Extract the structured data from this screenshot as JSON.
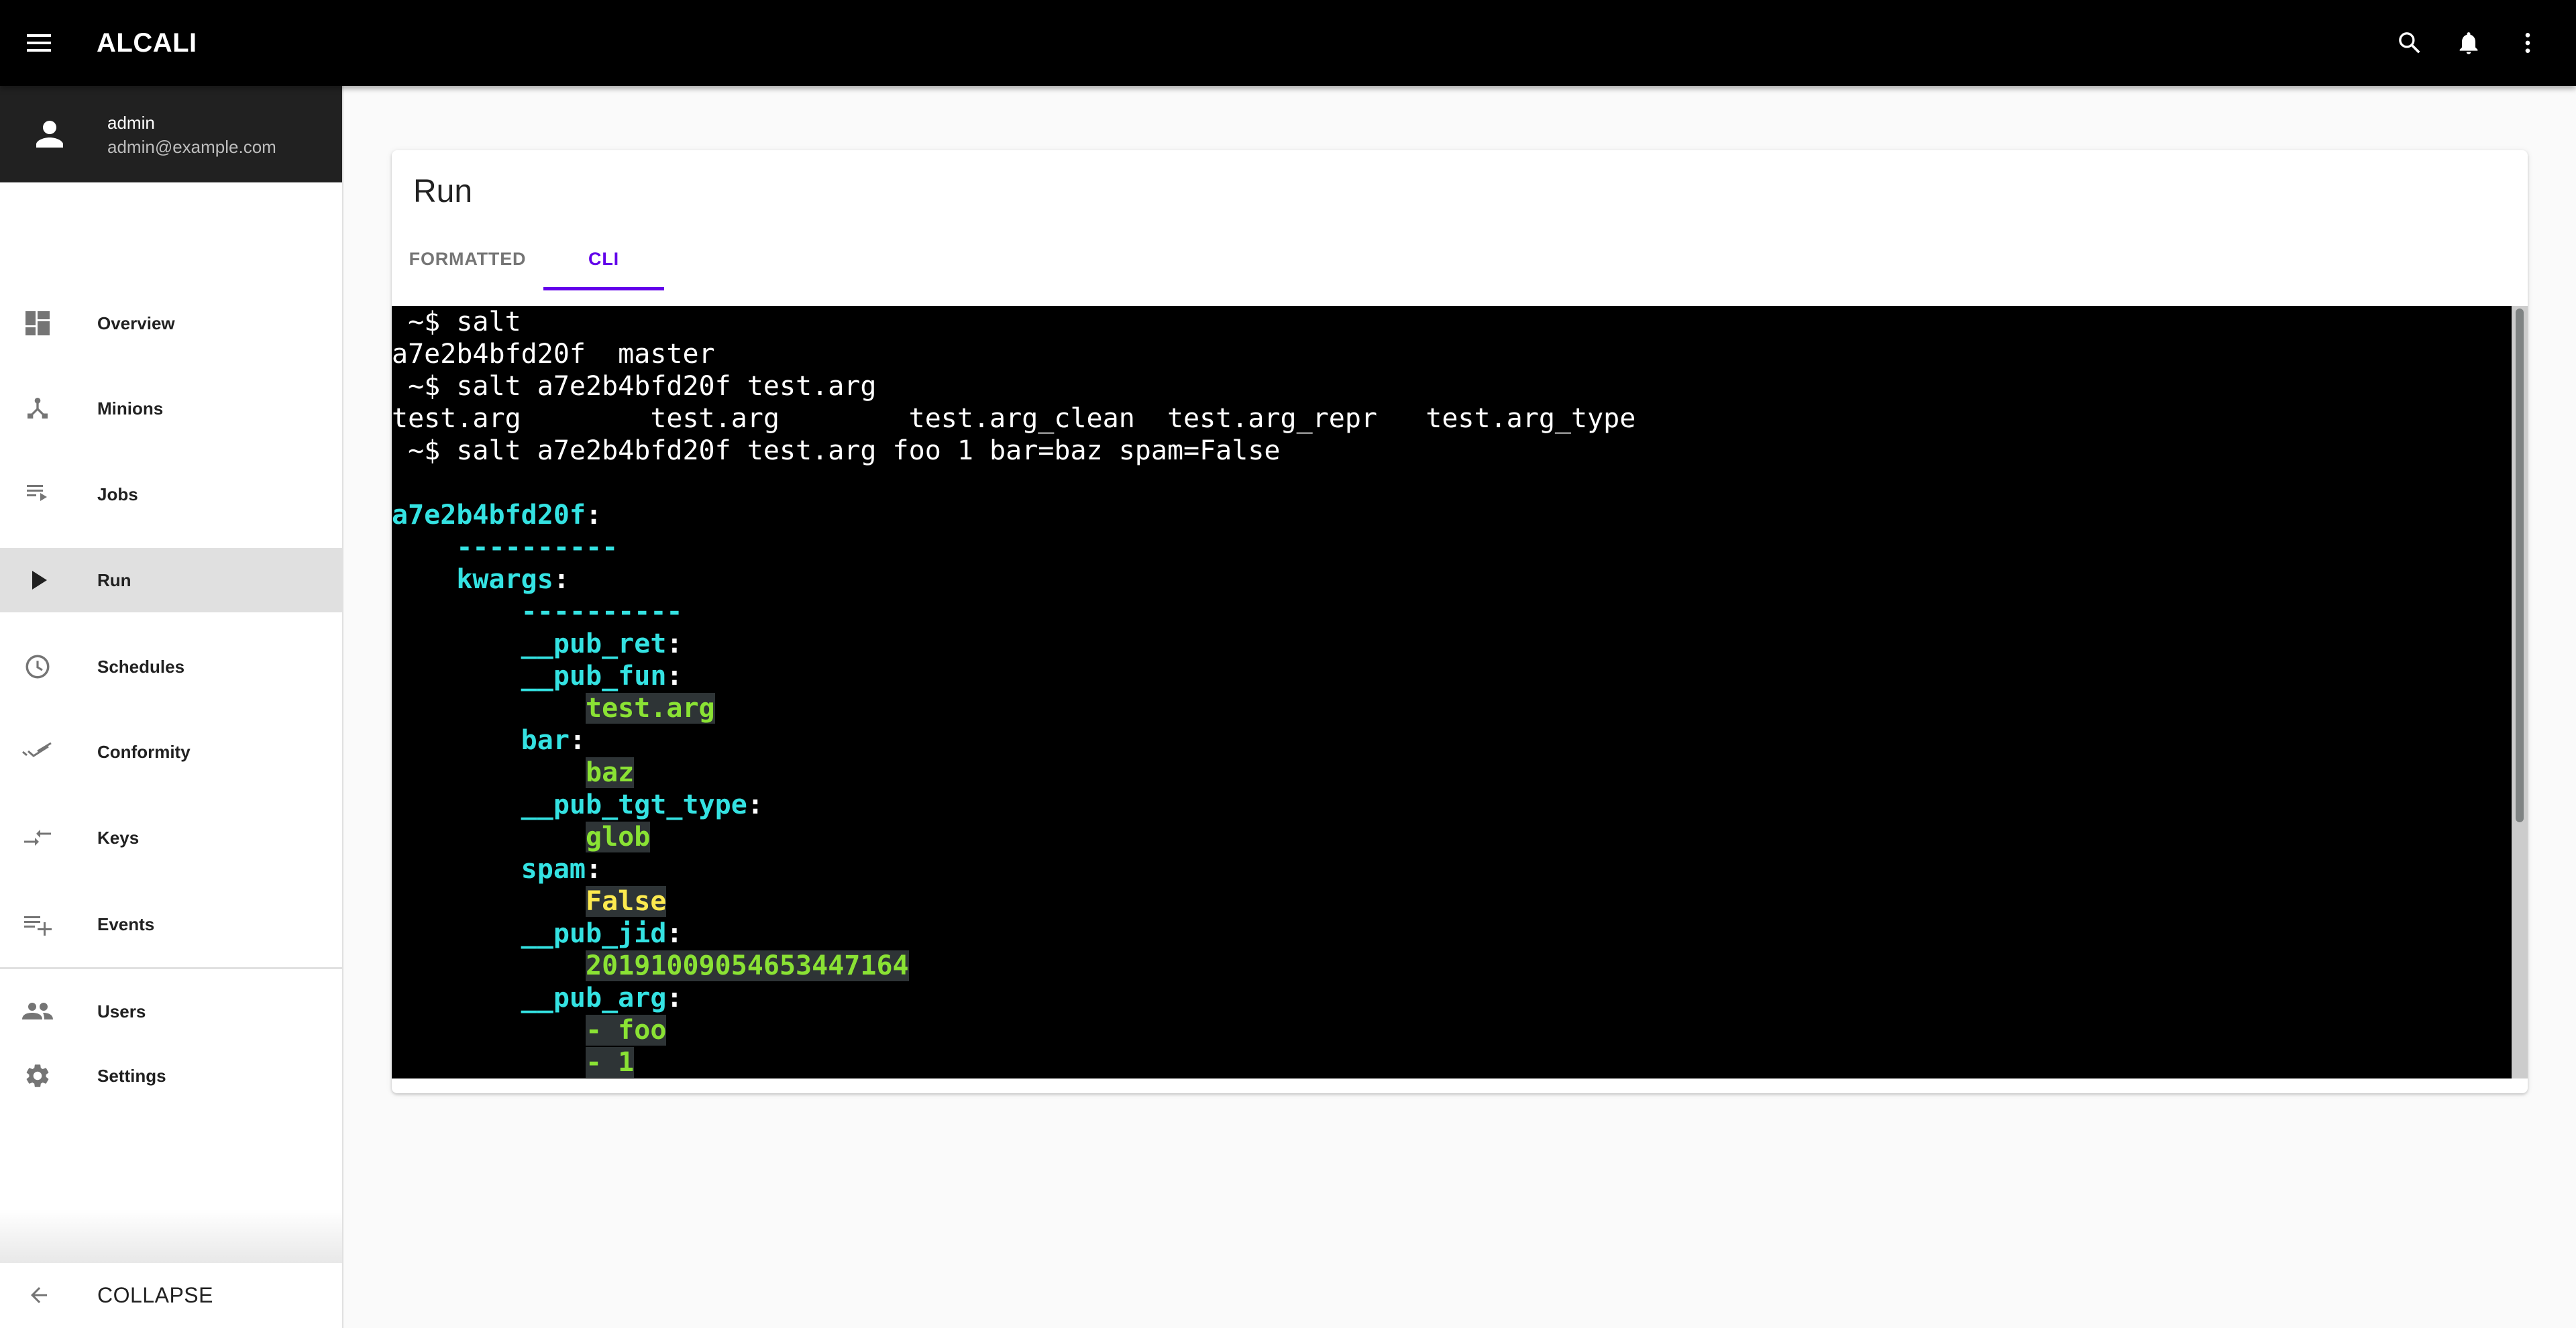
{
  "app": {
    "title": "ALCALI",
    "actions": [
      {
        "icon": "search-icon",
        "label": "Search"
      },
      {
        "icon": "bell-icon",
        "label": "Notifications"
      },
      {
        "icon": "more-vert-icon",
        "label": "More"
      }
    ]
  },
  "user": {
    "name": "admin",
    "email": "admin@example.com"
  },
  "sidebar": {
    "items": [
      {
        "label": "Overview",
        "icon": "dashboard-icon",
        "selected": false
      },
      {
        "label": "Minions",
        "icon": "device-hub-icon",
        "selected": false
      },
      {
        "label": "Jobs",
        "icon": "playlist-play-icon",
        "selected": false
      },
      {
        "label": "Run",
        "icon": "play-icon",
        "selected": true
      },
      {
        "label": "Schedules",
        "icon": "clock-icon",
        "selected": false
      },
      {
        "label": "Conformity",
        "icon": "done-all-icon",
        "selected": false
      },
      {
        "label": "Keys",
        "icon": "compare-arrows-icon",
        "selected": false
      },
      {
        "label": "Events",
        "icon": "playlist-add-icon",
        "selected": false
      }
    ],
    "secondary_items": [
      {
        "label": "Users",
        "icon": "people-icon"
      },
      {
        "label": "Settings",
        "icon": "gear-icon"
      }
    ],
    "collapse_label": "COLLAPSE"
  },
  "page": {
    "title": "Run",
    "tabs": [
      {
        "label": "FORMATTED",
        "active": false
      },
      {
        "label": "CLI",
        "active": true
      }
    ],
    "accent_color": "#6200ea"
  },
  "terminal": {
    "lines": [
      [
        {
          "t": " ~$ salt",
          "c": ""
        }
      ],
      [
        {
          "t": "a7e2b4bfd20f  master",
          "c": ""
        }
      ],
      [
        {
          "t": " ~$ salt a7e2b4bfd20f test.arg",
          "c": ""
        }
      ],
      [
        {
          "t": "test.arg        test.arg        test.arg_clean  test.arg_repr   test.arg_type",
          "c": ""
        }
      ],
      [
        {
          "t": " ~$ salt a7e2b4bfd20f test.arg foo 1 bar=baz spam=False",
          "c": ""
        }
      ],
      [
        {
          "t": "",
          "c": ""
        }
      ],
      [
        {
          "t": "a7e2b4bfd20f",
          "c": "key"
        },
        {
          "t": ":",
          "c": "punct"
        }
      ],
      [
        {
          "t": "    ",
          "c": ""
        },
        {
          "t": "----------",
          "c": "key"
        }
      ],
      [
        {
          "t": "    ",
          "c": ""
        },
        {
          "t": "kwargs",
          "c": "key"
        },
        {
          "t": ":",
          "c": "punct"
        }
      ],
      [
        {
          "t": "        ",
          "c": ""
        },
        {
          "t": "----------",
          "c": "key"
        }
      ],
      [
        {
          "t": "        ",
          "c": ""
        },
        {
          "t": "__pub_ret",
          "c": "key"
        },
        {
          "t": ":",
          "c": "punct"
        }
      ],
      [
        {
          "t": "        ",
          "c": ""
        },
        {
          "t": "__pub_fun",
          "c": "key"
        },
        {
          "t": ":",
          "c": "punct"
        }
      ],
      [
        {
          "t": "            ",
          "c": ""
        },
        {
          "t": "test.arg",
          "c": "val"
        }
      ],
      [
        {
          "t": "        ",
          "c": ""
        },
        {
          "t": "bar",
          "c": "key"
        },
        {
          "t": ":",
          "c": "punct"
        }
      ],
      [
        {
          "t": "            ",
          "c": ""
        },
        {
          "t": "baz",
          "c": "val"
        }
      ],
      [
        {
          "t": "        ",
          "c": ""
        },
        {
          "t": "__pub_tgt_type",
          "c": "key"
        },
        {
          "t": ":",
          "c": "punct"
        }
      ],
      [
        {
          "t": "            ",
          "c": ""
        },
        {
          "t": "glob",
          "c": "val"
        }
      ],
      [
        {
          "t": "        ",
          "c": ""
        },
        {
          "t": "spam",
          "c": "key"
        },
        {
          "t": ":",
          "c": "punct"
        }
      ],
      [
        {
          "t": "            ",
          "c": ""
        },
        {
          "t": "False",
          "c": "bool"
        }
      ],
      [
        {
          "t": "        ",
          "c": ""
        },
        {
          "t": "__pub_jid",
          "c": "key"
        },
        {
          "t": ":",
          "c": "punct"
        }
      ],
      [
        {
          "t": "            ",
          "c": ""
        },
        {
          "t": "20191009054653447164",
          "c": "val"
        }
      ],
      [
        {
          "t": "        ",
          "c": ""
        },
        {
          "t": "__pub_arg",
          "c": "key"
        },
        {
          "t": ":",
          "c": "punct"
        }
      ],
      [
        {
          "t": "            ",
          "c": ""
        },
        {
          "t": "- foo",
          "c": "val"
        }
      ],
      [
        {
          "t": "            ",
          "c": ""
        },
        {
          "t": "- 1",
          "c": "val"
        }
      ]
    ],
    "scroll_position": 0,
    "scroll_visible_fraction": 0.67
  }
}
